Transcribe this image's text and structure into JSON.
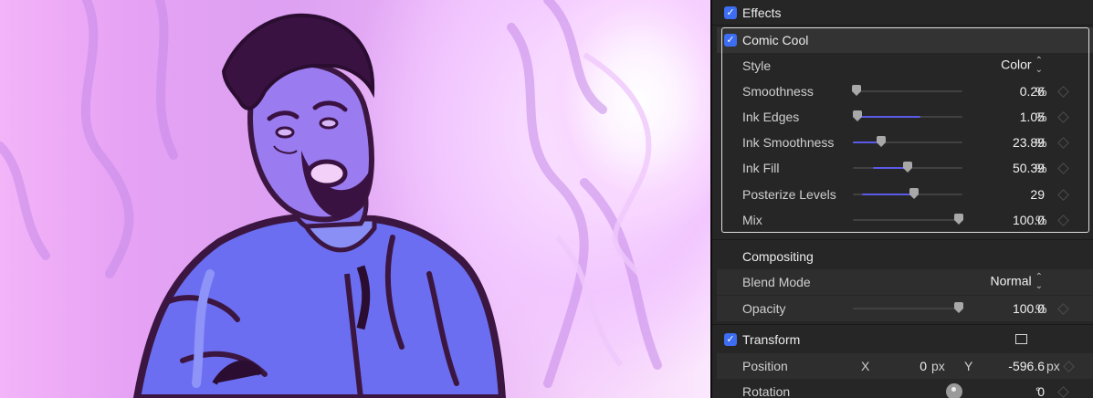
{
  "inspector": {
    "effects_header": "Effects",
    "effect": {
      "name": "Comic Cool",
      "style_label": "Style",
      "style_value": "Color",
      "params": [
        {
          "label": "Smoothness",
          "value": "0.26",
          "unit": "%",
          "level": 0.03
        },
        {
          "label": "Ink Edges",
          "value": "1.05",
          "unit": "%",
          "level": 0.04,
          "fill": 0.62
        },
        {
          "label": "Ink Smoothness",
          "value": "23.89",
          "unit": "%",
          "level": 0.26
        },
        {
          "label": "Ink Fill",
          "value": "50.39",
          "unit": "%",
          "level": 0.5,
          "fill_from": 0.18
        },
        {
          "label": "Posterize Levels",
          "value": "29",
          "unit": "",
          "level": 0.56,
          "fill_from": 0.08
        },
        {
          "label": "Mix",
          "value": "100.0",
          "unit": "%",
          "level": 0.97
        }
      ]
    },
    "compositing": {
      "header": "Compositing",
      "blend_label": "Blend Mode",
      "blend_value": "Normal",
      "opacity_label": "Opacity",
      "opacity_value": "100.0",
      "opacity_unit": "%",
      "opacity_level": 0.97
    },
    "transform": {
      "header": "Transform",
      "position_label": "Position",
      "x_label": "X",
      "x_value": "0",
      "x_unit": "px",
      "y_label": "Y",
      "y_value": "-596.6",
      "y_unit": "px",
      "rotation_label": "Rotation",
      "rotation_value": "0",
      "rotation_unit": "°"
    }
  },
  "colors": {
    "accent": "#3d6ef2",
    "slider_fill": "#5a5ae8",
    "panel_bg": "#262626"
  },
  "icons": {
    "checkbox": "checkmark-icon",
    "popup": "chevron-updown-icon",
    "keyframe": "diamond-keyframe-icon",
    "transform": "transform-onscreen-icon",
    "rotation": "rotation-dial-icon"
  }
}
